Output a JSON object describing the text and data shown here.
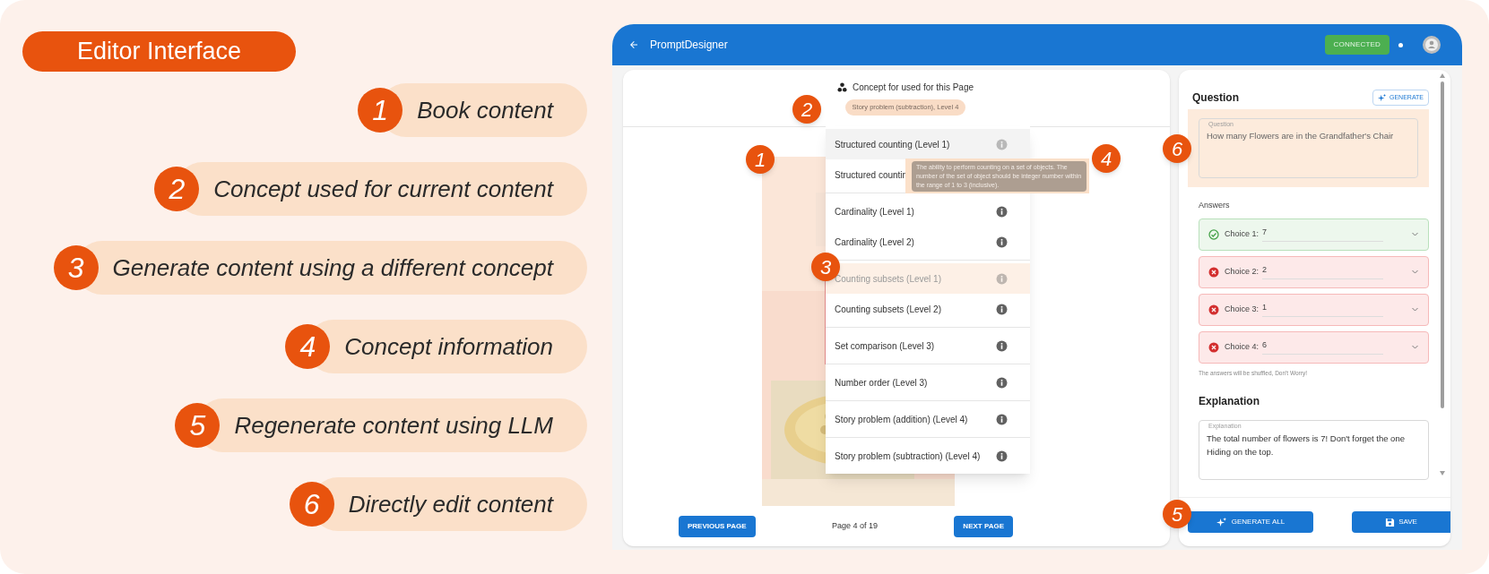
{
  "legend": {
    "title": "Editor Interface",
    "items": [
      {
        "number": "1",
        "label": "Book content"
      },
      {
        "number": "2",
        "label": "Concept used for current content"
      },
      {
        "number": "3",
        "label": "Generate content using a different concept"
      },
      {
        "number": "4",
        "label": "Concept information"
      },
      {
        "number": "5",
        "label": "Regenerate content using LLM"
      },
      {
        "number": "6",
        "label": "Directly edit content"
      }
    ]
  },
  "app": {
    "title": "PromptDesigner",
    "status": "CONNECTED",
    "concept_panel": {
      "heading": "Concept for used for this Page",
      "current_concept": {
        "label": "Story problem (subtraction), Level 4",
        "highlighted": true
      },
      "menu": {
        "groups": [
          {
            "items": [
              {
                "label": "Structured counting (Level 1)",
                "hovered": true,
                "highlighted": false
              },
              {
                "label": "Structured countin",
                "hovered": false,
                "highlighted": false
              }
            ]
          },
          {
            "items": [
              {
                "label": "Cardinality (Level 1)",
                "hovered": false,
                "highlighted": false
              },
              {
                "label": "Cardinality (Level 2)",
                "hovered": false,
                "highlighted": false
              }
            ]
          },
          {
            "items": [
              {
                "label": "Counting subsets (Level 1)",
                "hovered": false,
                "highlighted": true
              },
              {
                "label": "Counting subsets (Level 2)",
                "hovered": false,
                "highlighted": false
              }
            ]
          },
          {
            "items": [
              {
                "label": "Set comparison (Level 3)",
                "hovered": false,
                "highlighted": false
              }
            ]
          },
          {
            "items": [
              {
                "label": "Number order (Level 3)",
                "hovered": false,
                "highlighted": false
              }
            ]
          },
          {
            "items": [
              {
                "label": "Story problem (addition) (Level 4)",
                "hovered": false,
                "highlighted": false
              }
            ]
          },
          {
            "items": [
              {
                "label": "Story problem (subtraction) (Level 4)",
                "hovered": false,
                "highlighted": false
              }
            ]
          }
        ]
      },
      "tooltip": {
        "text": "The ability to perform counting on a set of objects. The number of the set of object should be integer number within the range of 1 to 3 (inclusive).",
        "highlighted": true
      },
      "previous_button": "PREVIOUS PAGE",
      "page_label": "Page 4 of 19",
      "next_button": "NEXT PAGE"
    },
    "question_panel": {
      "heading": "Question",
      "generate_button": "GENERATE",
      "question_field": {
        "label": "Question",
        "value": "How many Flowers are in the Grandfather's Chair",
        "highlighted": true
      },
      "answers_label": "Answers",
      "choices": [
        {
          "label": "Choice 1:",
          "value": "7",
          "correct": true
        },
        {
          "label": "Choice 2:",
          "value": "2",
          "correct": false
        },
        {
          "label": "Choice 3:",
          "value": "1",
          "correct": false
        },
        {
          "label": "Choice 4:",
          "value": "6",
          "correct": false
        }
      ],
      "note": "The answers will be shuffled, Don't Worry!",
      "explanation_heading": "Explanation",
      "explanation_field": {
        "label": "Explanation",
        "value": "The total number of flowers is 7! Don't forget the one Hiding on the top."
      },
      "generate_all_button": "GENERATE ALL",
      "save_button": "SAVE"
    }
  },
  "annotations": [
    {
      "number": "1"
    },
    {
      "number": "2"
    },
    {
      "number": "3"
    },
    {
      "number": "4"
    },
    {
      "number": "5"
    },
    {
      "number": "6"
    }
  ]
}
